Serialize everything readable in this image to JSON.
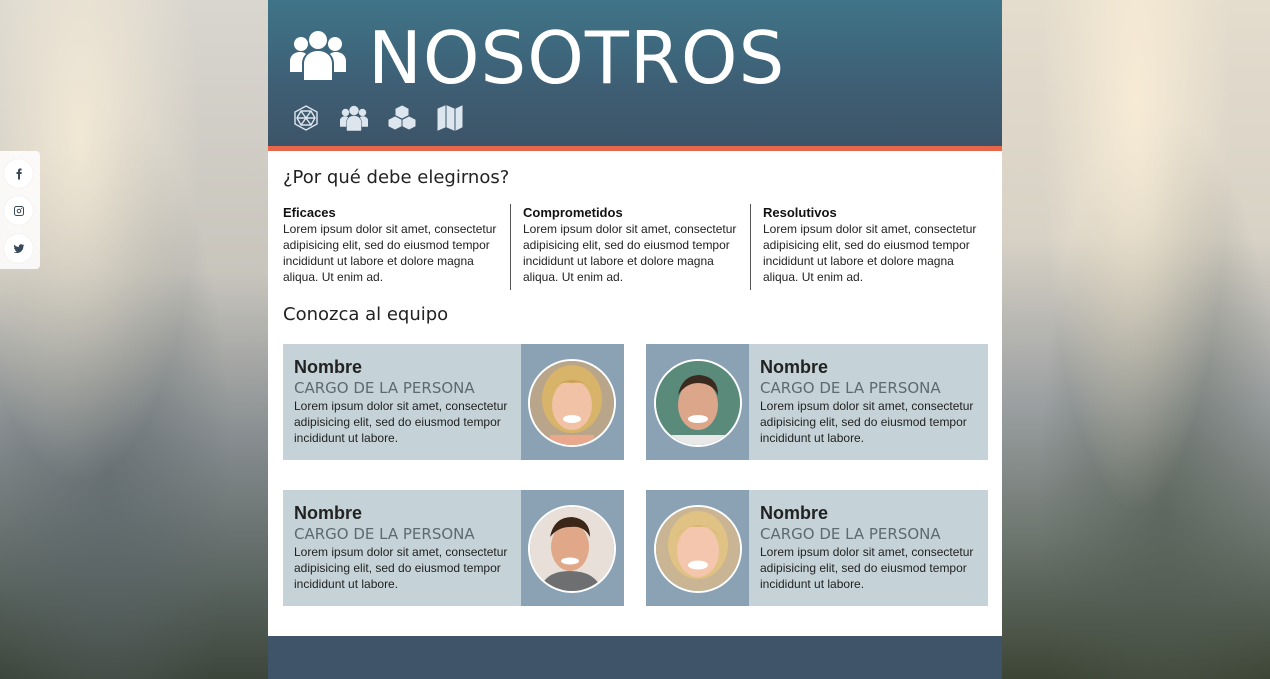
{
  "header": {
    "title": "NOSOTROS",
    "title_icon": "users-icon",
    "nav": [
      {
        "icon": "geodesic-icon"
      },
      {
        "icon": "users-icon"
      },
      {
        "icon": "cubes-icon"
      },
      {
        "icon": "map-icon"
      }
    ],
    "colors": {
      "header_top": "#3f7488",
      "header_bottom": "#3d5468",
      "accent": "#e8674a"
    }
  },
  "social": [
    {
      "icon": "facebook-icon"
    },
    {
      "icon": "instagram-icon"
    },
    {
      "icon": "twitter-icon"
    }
  ],
  "why": {
    "title": "¿Por qué debe elegirnos?",
    "features": [
      {
        "title": "Eficaces",
        "text": "Lorem ipsum dolor sit amet, consectetur adipisicing elit, sed do eiusmod tempor incididunt ut labore et dolore magna aliqua. Ut enim ad."
      },
      {
        "title": "Comprometidos",
        "text": "Lorem ipsum dolor sit amet, consectetur adipisicing elit, sed do eiusmod tempor incididunt ut labore et dolore magna aliqua. Ut enim ad."
      },
      {
        "title": "Resolutivos",
        "text": "Lorem ipsum dolor sit amet, consectetur adipisicing elit, sed do eiusmod tempor incididunt ut labore et dolore magna aliqua. Ut enim ad."
      }
    ]
  },
  "team": {
    "title": "Conozca al equipo",
    "members": [
      {
        "name": "Nombre",
        "role": "CARGO DE LA PERSONA",
        "text": "Lorem ipsum dolor sit amet, consectetur adipisicing elit, sed do eiusmod tempor incididunt ut labore."
      },
      {
        "name": "Nombre",
        "role": "CARGO DE LA PERSONA",
        "text": "Lorem ipsum dolor sit amet, consectetur adipisicing elit, sed do eiusmod tempor incididunt ut labore."
      },
      {
        "name": "Nombre",
        "role": "CARGO DE LA PERSONA",
        "text": "Lorem ipsum dolor sit amet, consectetur adipisicing elit, sed do eiusmod tempor incididunt ut labore."
      },
      {
        "name": "Nombre",
        "role": "CARGO DE LA PERSONA",
        "text": "Lorem ipsum dolor sit amet, consectetur adipisicing elit, sed do eiusmod tempor incididunt ut labore."
      }
    ]
  }
}
